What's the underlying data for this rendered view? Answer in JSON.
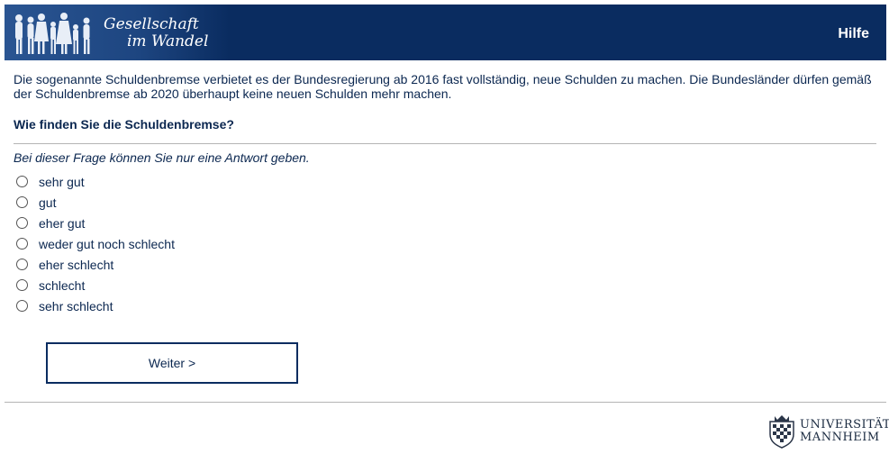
{
  "header": {
    "brand_line1": "Gesellschaft",
    "brand_line2": "im Wandel",
    "help_label": "Hilfe",
    "background_color": "#0a2c60"
  },
  "intro_text": "Die sogenannte Schuldenbremse verbietet es der Bundesregierung ab 2016 fast vollständig, neue Schulden zu machen. Die Bundesländer dürfen gemäß der Schuldenbremse ab 2020 überhaupt keine neuen Schulden mehr machen.",
  "question": "Wie finden Sie die Schuldenbremse?",
  "hint": "Bei dieser Frage können Sie nur eine Antwort geben.",
  "options": [
    {
      "label": "sehr gut",
      "selected": false
    },
    {
      "label": "gut",
      "selected": false
    },
    {
      "label": "eher gut",
      "selected": false
    },
    {
      "label": "weder gut noch schlecht",
      "selected": false
    },
    {
      "label": "eher schlecht",
      "selected": false
    },
    {
      "label": "schlecht",
      "selected": false
    },
    {
      "label": "sehr schlecht",
      "selected": false
    }
  ],
  "next_button_label": "Weiter >",
  "footer": {
    "university_line1": "UNIVERSITÄT",
    "university_line2": "MANNHEIM",
    "crest_icon": "crest-icon"
  }
}
